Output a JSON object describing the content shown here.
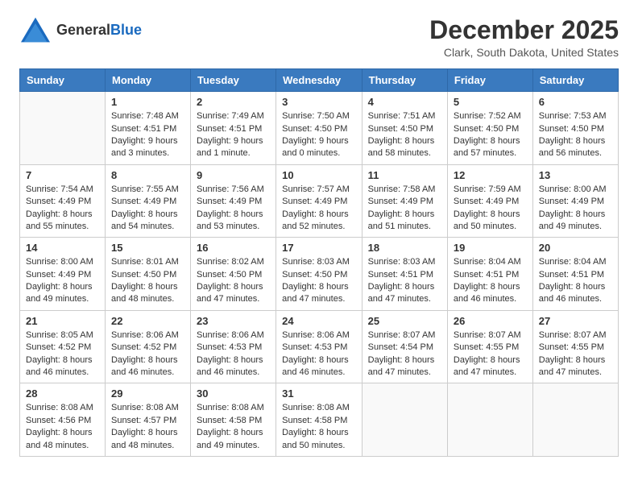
{
  "header": {
    "logo_general": "General",
    "logo_blue": "Blue",
    "month": "December 2025",
    "location": "Clark, South Dakota, United States"
  },
  "days_of_week": [
    "Sunday",
    "Monday",
    "Tuesday",
    "Wednesday",
    "Thursday",
    "Friday",
    "Saturday"
  ],
  "weeks": [
    [
      {
        "day": "",
        "info": ""
      },
      {
        "day": "1",
        "info": "Sunrise: 7:48 AM\nSunset: 4:51 PM\nDaylight: 9 hours\nand 3 minutes."
      },
      {
        "day": "2",
        "info": "Sunrise: 7:49 AM\nSunset: 4:51 PM\nDaylight: 9 hours\nand 1 minute."
      },
      {
        "day": "3",
        "info": "Sunrise: 7:50 AM\nSunset: 4:50 PM\nDaylight: 9 hours\nand 0 minutes."
      },
      {
        "day": "4",
        "info": "Sunrise: 7:51 AM\nSunset: 4:50 PM\nDaylight: 8 hours\nand 58 minutes."
      },
      {
        "day": "5",
        "info": "Sunrise: 7:52 AM\nSunset: 4:50 PM\nDaylight: 8 hours\nand 57 minutes."
      },
      {
        "day": "6",
        "info": "Sunrise: 7:53 AM\nSunset: 4:50 PM\nDaylight: 8 hours\nand 56 minutes."
      }
    ],
    [
      {
        "day": "7",
        "info": "Sunrise: 7:54 AM\nSunset: 4:49 PM\nDaylight: 8 hours\nand 55 minutes."
      },
      {
        "day": "8",
        "info": "Sunrise: 7:55 AM\nSunset: 4:49 PM\nDaylight: 8 hours\nand 54 minutes."
      },
      {
        "day": "9",
        "info": "Sunrise: 7:56 AM\nSunset: 4:49 PM\nDaylight: 8 hours\nand 53 minutes."
      },
      {
        "day": "10",
        "info": "Sunrise: 7:57 AM\nSunset: 4:49 PM\nDaylight: 8 hours\nand 52 minutes."
      },
      {
        "day": "11",
        "info": "Sunrise: 7:58 AM\nSunset: 4:49 PM\nDaylight: 8 hours\nand 51 minutes."
      },
      {
        "day": "12",
        "info": "Sunrise: 7:59 AM\nSunset: 4:49 PM\nDaylight: 8 hours\nand 50 minutes."
      },
      {
        "day": "13",
        "info": "Sunrise: 8:00 AM\nSunset: 4:49 PM\nDaylight: 8 hours\nand 49 minutes."
      }
    ],
    [
      {
        "day": "14",
        "info": "Sunrise: 8:00 AM\nSunset: 4:49 PM\nDaylight: 8 hours\nand 49 minutes."
      },
      {
        "day": "15",
        "info": "Sunrise: 8:01 AM\nSunset: 4:50 PM\nDaylight: 8 hours\nand 48 minutes."
      },
      {
        "day": "16",
        "info": "Sunrise: 8:02 AM\nSunset: 4:50 PM\nDaylight: 8 hours\nand 47 minutes."
      },
      {
        "day": "17",
        "info": "Sunrise: 8:03 AM\nSunset: 4:50 PM\nDaylight: 8 hours\nand 47 minutes."
      },
      {
        "day": "18",
        "info": "Sunrise: 8:03 AM\nSunset: 4:51 PM\nDaylight: 8 hours\nand 47 minutes."
      },
      {
        "day": "19",
        "info": "Sunrise: 8:04 AM\nSunset: 4:51 PM\nDaylight: 8 hours\nand 46 minutes."
      },
      {
        "day": "20",
        "info": "Sunrise: 8:04 AM\nSunset: 4:51 PM\nDaylight: 8 hours\nand 46 minutes."
      }
    ],
    [
      {
        "day": "21",
        "info": "Sunrise: 8:05 AM\nSunset: 4:52 PM\nDaylight: 8 hours\nand 46 minutes."
      },
      {
        "day": "22",
        "info": "Sunrise: 8:06 AM\nSunset: 4:52 PM\nDaylight: 8 hours\nand 46 minutes."
      },
      {
        "day": "23",
        "info": "Sunrise: 8:06 AM\nSunset: 4:53 PM\nDaylight: 8 hours\nand 46 minutes."
      },
      {
        "day": "24",
        "info": "Sunrise: 8:06 AM\nSunset: 4:53 PM\nDaylight: 8 hours\nand 46 minutes."
      },
      {
        "day": "25",
        "info": "Sunrise: 8:07 AM\nSunset: 4:54 PM\nDaylight: 8 hours\nand 47 minutes."
      },
      {
        "day": "26",
        "info": "Sunrise: 8:07 AM\nSunset: 4:55 PM\nDaylight: 8 hours\nand 47 minutes."
      },
      {
        "day": "27",
        "info": "Sunrise: 8:07 AM\nSunset: 4:55 PM\nDaylight: 8 hours\nand 47 minutes."
      }
    ],
    [
      {
        "day": "28",
        "info": "Sunrise: 8:08 AM\nSunset: 4:56 PM\nDaylight: 8 hours\nand 48 minutes."
      },
      {
        "day": "29",
        "info": "Sunrise: 8:08 AM\nSunset: 4:57 PM\nDaylight: 8 hours\nand 48 minutes."
      },
      {
        "day": "30",
        "info": "Sunrise: 8:08 AM\nSunset: 4:58 PM\nDaylight: 8 hours\nand 49 minutes."
      },
      {
        "day": "31",
        "info": "Sunrise: 8:08 AM\nSunset: 4:58 PM\nDaylight: 8 hours\nand 50 minutes."
      },
      {
        "day": "",
        "info": ""
      },
      {
        "day": "",
        "info": ""
      },
      {
        "day": "",
        "info": ""
      }
    ]
  ]
}
